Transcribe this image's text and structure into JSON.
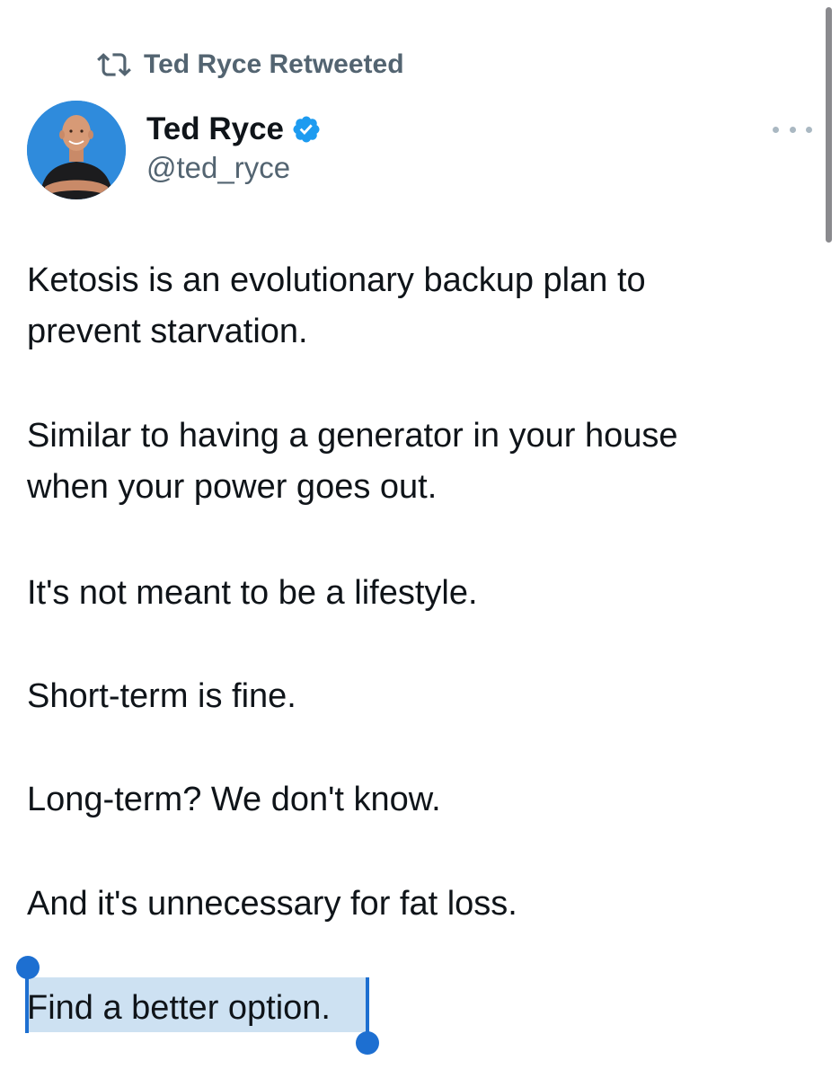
{
  "retweet_banner": {
    "icon": "retweet-icon",
    "text": "Ted Ryce Retweeted"
  },
  "author": {
    "name": "Ted Ryce",
    "handle": "@ted_ryce",
    "verified": true,
    "verified_color": "#1d9bf0",
    "avatar_bg": "#2f8bdc"
  },
  "menu": {
    "icon": "more-options-icon"
  },
  "tweet": {
    "paragraphs": [
      [
        "Ketosis is an evolutionary backup plan to",
        "prevent starvation."
      ],
      [
        "Similar to having a generator in your house",
        "when your power goes out."
      ],
      [
        "It's not meant to be a lifestyle."
      ],
      [
        "Short-term is fine."
      ],
      [
        "Long-term? We don't know."
      ],
      [
        "And it's unnecessary for fat loss."
      ],
      [
        "Find a better option."
      ]
    ]
  },
  "selection": {
    "selected_text": "Find a better option.",
    "handle_color": "#1d6fd1",
    "highlight_color": "#cde1f2"
  }
}
